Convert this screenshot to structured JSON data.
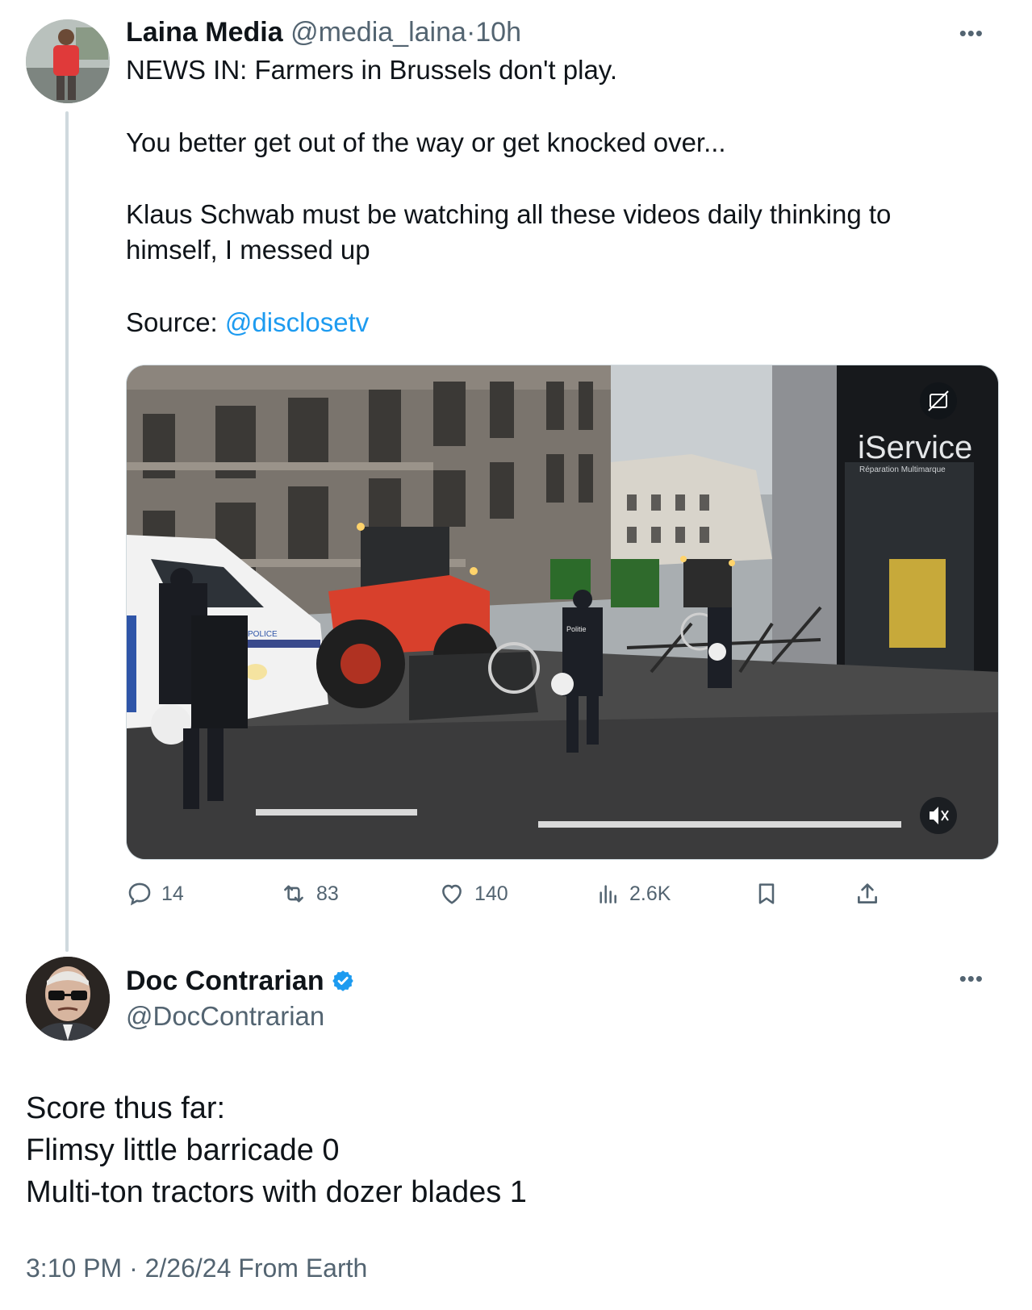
{
  "original_tweet": {
    "author_name": "Laina Media",
    "handle": "@media_laina",
    "separator": "·",
    "time_ago": "10h",
    "lines": {
      "l1": "NEWS IN: Farmers in Brussels don't play.",
      "l2": "You better get out of the way or get knocked over...",
      "l3": "Klaus Schwab must be watching all these videos daily thinking to",
      "l4": "himself, I messed up",
      "source_label": "Source: ",
      "source_link": "@disclosetv"
    },
    "video": {
      "sign_text": "iService",
      "sign_subtext": "Réparation Multimarque",
      "vest_text": "Politie",
      "van_text": "POLICE"
    },
    "stats": {
      "replies": "14",
      "reposts": "83",
      "likes": "140",
      "views": "2.6K"
    }
  },
  "reply_tweet": {
    "author_name": "Doc Contrarian",
    "handle": "@DocContrarian",
    "verified": true,
    "lines": {
      "l1": "Score thus far:",
      "l2": "Flimsy little barricade 0",
      "l3": "Multi-ton tractors with dozer blades 1"
    },
    "timestamp": "3:10 PM · 2/26/24 From Earth"
  },
  "colors": {
    "text": "#0f1419",
    "muted": "#536471",
    "link": "#1d9bf0",
    "verified": "#1d9bf0",
    "thread_line": "#cfd9de"
  },
  "icons": [
    "more-icon",
    "reply-icon",
    "repost-icon",
    "like-icon",
    "views-icon",
    "bookmark-icon",
    "share-icon",
    "captions-icon",
    "muted-volume-icon",
    "verified-badge-icon"
  ]
}
